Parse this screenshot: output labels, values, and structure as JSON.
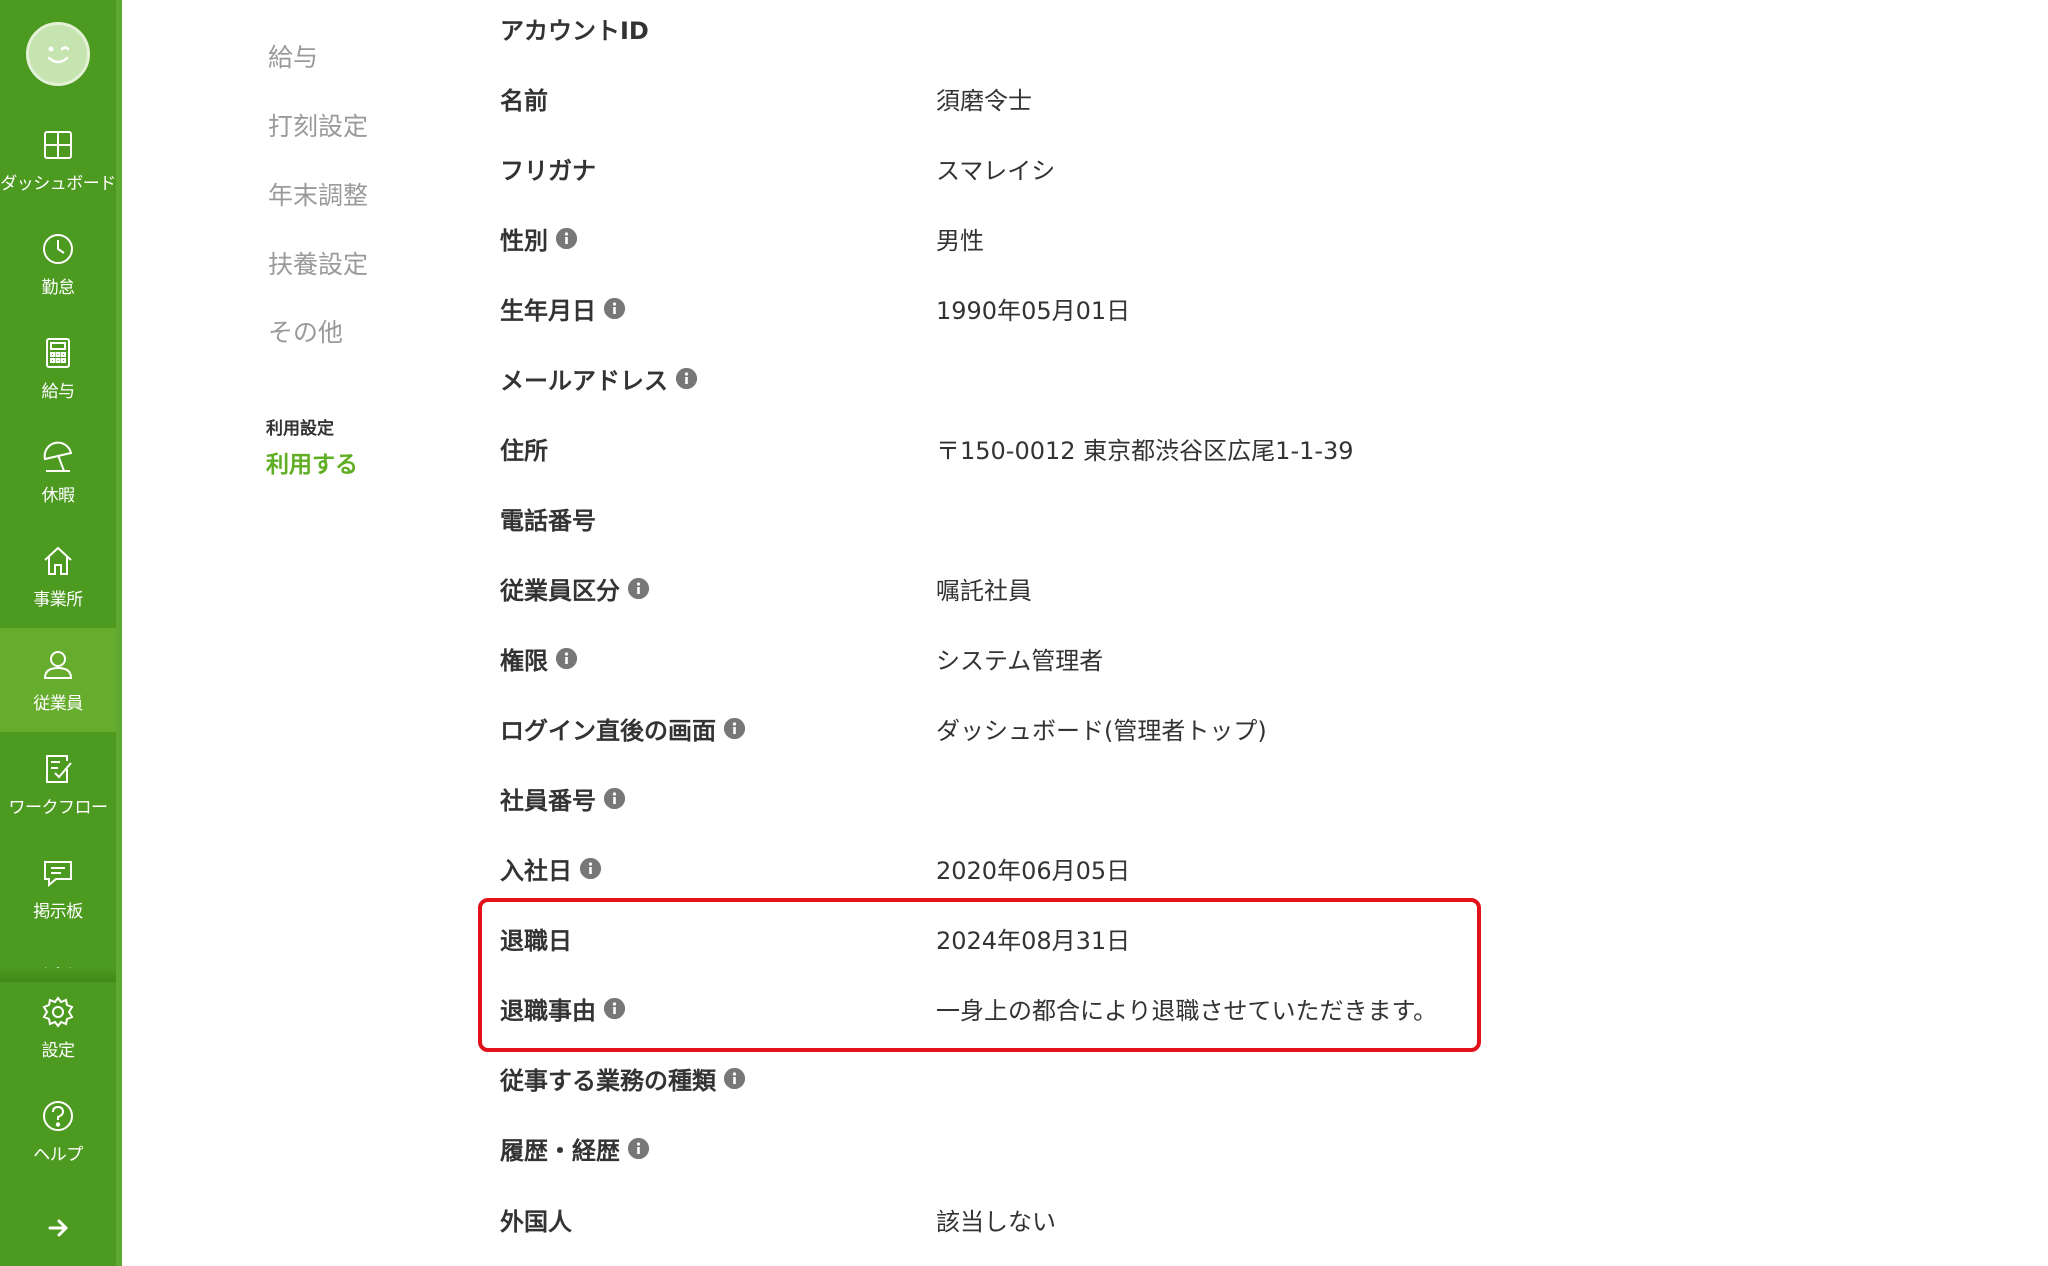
{
  "sidebar": {
    "items": [
      {
        "label": "ダッシュボード",
        "icon": "dashboard-grid-icon"
      },
      {
        "label": "勤怠",
        "icon": "clock-icon"
      },
      {
        "label": "給与",
        "icon": "calculator-icon"
      },
      {
        "label": "休暇",
        "icon": "beach-umbrella-icon"
      },
      {
        "label": "事業所",
        "icon": "home-icon"
      },
      {
        "label": "従業員",
        "icon": "person-icon"
      },
      {
        "label": "ワークフロー",
        "icon": "checklist-icon"
      },
      {
        "label": "掲示板",
        "icon": "chat-icon"
      }
    ],
    "bottom_items": [
      {
        "label": "設定",
        "icon": "gear-icon"
      },
      {
        "label": "ヘルプ",
        "icon": "help-icon"
      }
    ],
    "active_item": "従業員"
  },
  "subnav": {
    "items": [
      "給与",
      "打刻設定",
      "年末調整",
      "扶養設定",
      "その他"
    ],
    "usage_heading": "利用設定",
    "usage_value": "利用する"
  },
  "details": {
    "rows": [
      {
        "label": "アカウントID",
        "value": ""
      },
      {
        "label": "名前",
        "value": "須磨令士"
      },
      {
        "label": "フリガナ",
        "value": "スマレイシ"
      },
      {
        "label": "性別",
        "value": "男性"
      },
      {
        "label": "生年月日",
        "value": "1990年05月01日"
      },
      {
        "label": "メールアドレス",
        "value": ""
      },
      {
        "label": "住所",
        "value": "〒150-0012 東京都渋谷区広尾1-1-39"
      },
      {
        "label": "電話番号",
        "value": ""
      },
      {
        "label": "従業員区分",
        "value": "嘱託社員"
      },
      {
        "label": "権限",
        "value": "システム管理者"
      },
      {
        "label": "ログイン直後の画面",
        "value": "ダッシュボード(管理者トップ)"
      },
      {
        "label": "社員番号",
        "value": ""
      },
      {
        "label": "入社日",
        "value": "2020年06月05日"
      },
      {
        "label": "退職日",
        "value": "2024年08月31日"
      },
      {
        "label": "退職事由",
        "value": "一身上の都合により退職させていただきます。"
      },
      {
        "label": "従事する業務の種類",
        "value": ""
      },
      {
        "label": "履歴・経歴",
        "value": ""
      },
      {
        "label": "外国人",
        "value": "該当しない"
      }
    ]
  },
  "colors": {
    "sidebar": "#4d9a21",
    "sidebar_active": "#66ad2e",
    "accent_green": "#5fae24",
    "highlight_red": "#e3111a",
    "info_icon": "#777777"
  }
}
